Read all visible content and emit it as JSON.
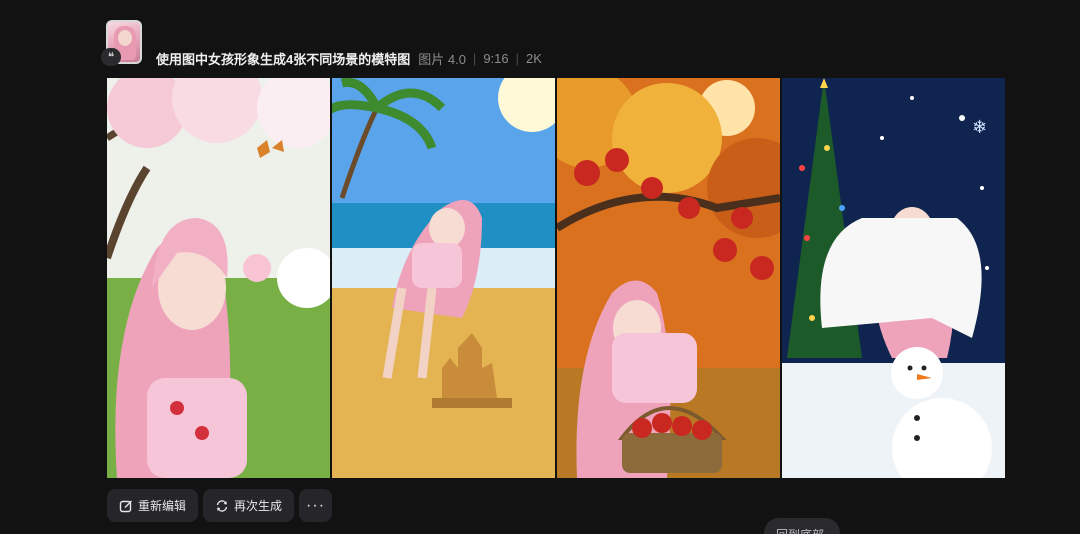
{
  "reference": {
    "quote_icon": "quote-icon",
    "quote_glyph": "❝"
  },
  "header": {
    "prompt": "使用图中女孩形象生成4张不同场景的模特图",
    "model": "图片 4.0",
    "ratio": "9:16",
    "resolution": "2K"
  },
  "images": [
    {
      "scene": "spring",
      "sky": "#f4f1ee",
      "accent": "#f2c0cf"
    },
    {
      "scene": "beach",
      "sky": "#4f9ee8",
      "accent": "#e8b04a"
    },
    {
      "scene": "autumn",
      "sky": "#f08a2a",
      "accent": "#c8281f"
    },
    {
      "scene": "winter",
      "sky": "#0f2550",
      "accent": "#ffffff"
    }
  ],
  "actions": {
    "reedit": "重新编辑",
    "regenerate": "再次生成",
    "more": "···"
  },
  "scroll_hint": "回到底部 ⌄",
  "colors": {
    "background": "#121212",
    "button": "#26262a",
    "hair": "#eea3bb"
  }
}
